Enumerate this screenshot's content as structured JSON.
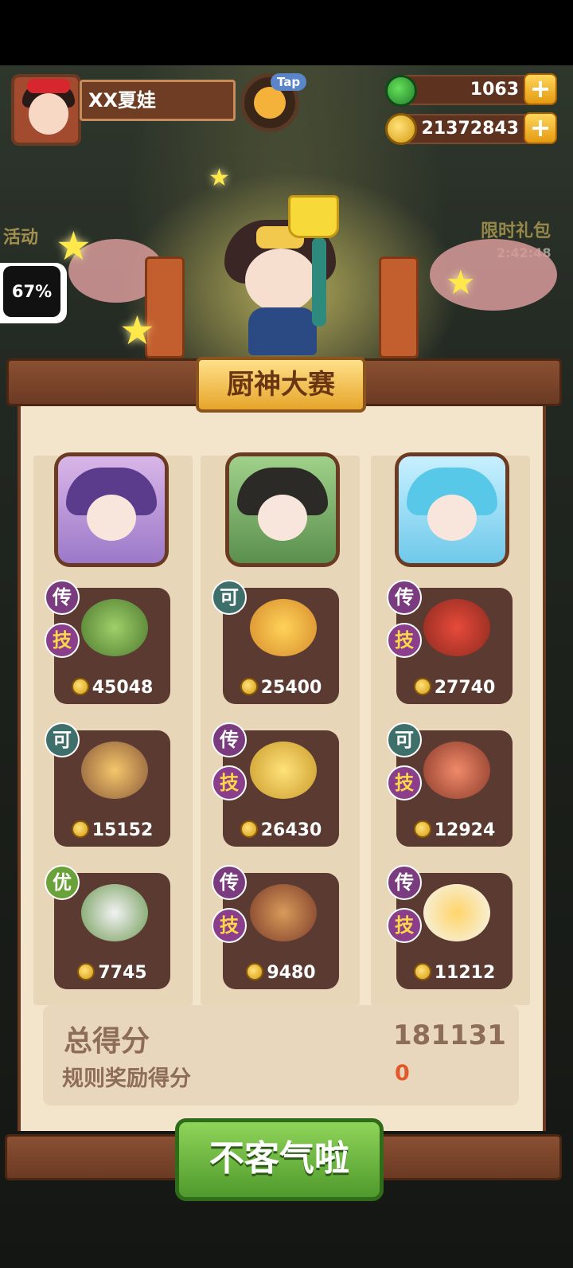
{
  "player": {
    "name": "XX夏娃",
    "tap_label": "Tap"
  },
  "resources": {
    "jade": "1063",
    "coins": "21372843"
  },
  "side": {
    "activity": "活动",
    "gift": "限时礼包",
    "timer": "2:42:48"
  },
  "progress_percent": "67%",
  "title": "厨神大赛",
  "cards": [
    [
      {
        "badges": [
          "传",
          "技"
        ],
        "price": "45048"
      },
      {
        "badges": [
          "可"
        ],
        "price": "15152"
      },
      {
        "badges": [
          "优"
        ],
        "price": "7745"
      }
    ],
    [
      {
        "badges": [
          "可"
        ],
        "price": "25400"
      },
      {
        "badges": [
          "传",
          "技"
        ],
        "price": "26430"
      },
      {
        "badges": [
          "传",
          "技"
        ],
        "price": "9480"
      }
    ],
    [
      {
        "badges": [
          "传",
          "技"
        ],
        "price": "27740"
      },
      {
        "badges": [
          "可",
          "技"
        ],
        "price": "12924"
      },
      {
        "badges": [
          "传",
          "技"
        ],
        "price": "11212"
      }
    ]
  ],
  "score": {
    "total_label": "总得分",
    "total_value": "181131",
    "rule_label": "规则奖励得分",
    "rule_value": "0"
  },
  "confirm_label": "不客气啦",
  "colors": {
    "wood": "#6b3a23",
    "board": "#f3e4cc",
    "button": "#5fb23a",
    "highlight": "#e2582b"
  }
}
